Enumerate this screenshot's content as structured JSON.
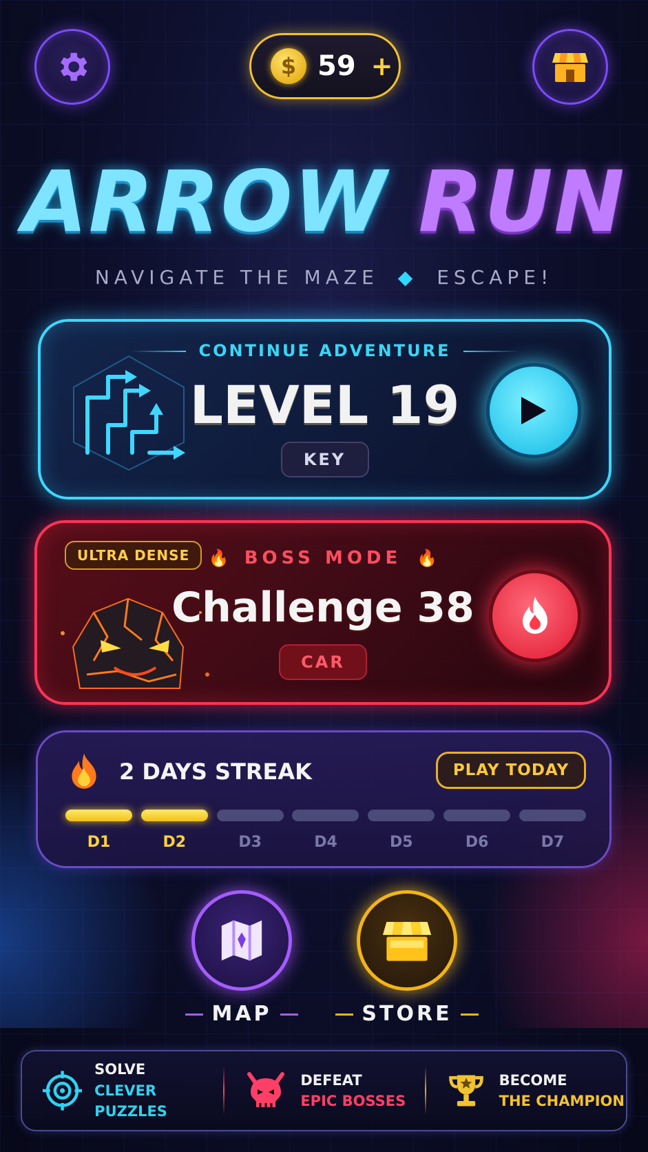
{
  "topbar": {
    "coins": "59",
    "coin_plus": "+",
    "coin_symbol": "$"
  },
  "title": {
    "word1": "ARROW",
    "word2": "RUN",
    "subtitle_left": "NAVIGATE THE MAZE",
    "subtitle_sep": "◆",
    "subtitle_right": "ESCAPE!"
  },
  "level_card": {
    "kicker": "CONTINUE ADVENTURE",
    "title": "LEVEL 19",
    "tag": "KEY"
  },
  "boss_card": {
    "badge": "ULTRA DENSE",
    "kicker": "BOSS MODE",
    "title": "Challenge 38",
    "tag": "CAR"
  },
  "streak": {
    "text": "2 DAYS STREAK",
    "button": "PLAY TODAY",
    "days": [
      {
        "label": "D1",
        "done": true
      },
      {
        "label": "D2",
        "done": true
      },
      {
        "label": "D3",
        "done": false
      },
      {
        "label": "D4",
        "done": false
      },
      {
        "label": "D5",
        "done": false
      },
      {
        "label": "D6",
        "done": false
      },
      {
        "label": "D7",
        "done": false
      }
    ]
  },
  "nav": {
    "map_label": "MAP",
    "store_label": "STORE"
  },
  "footer": {
    "features": [
      {
        "line1": "SOLVE",
        "line2": "CLEVER PUZZLES",
        "color": "#2ed3f0",
        "icon": "target-icon"
      },
      {
        "line1": "DEFEAT",
        "line2": "EPIC BOSSES",
        "color": "#ff3f66",
        "icon": "demon-skull-icon"
      },
      {
        "line1": "BECOME",
        "line2": "THE CHAMPION",
        "color": "#f2c230",
        "icon": "trophy-icon"
      }
    ]
  },
  "colors": {
    "cyan": "#3fd7ff",
    "purple": "#a55cff",
    "red": "#ff3355",
    "gold": "#f2c230"
  }
}
